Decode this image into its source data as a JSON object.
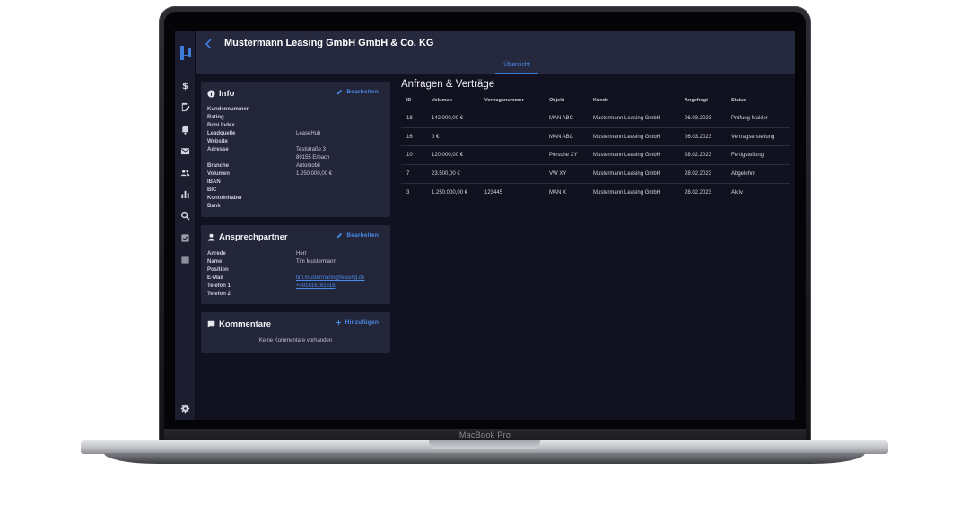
{
  "device": {
    "label": "MacBook Pro"
  },
  "app": {
    "title": "Mustermann Leasing GmbH GmbH & Co. KG",
    "tabs": [
      {
        "label": "Übersicht",
        "active": true
      }
    ],
    "accent_color": "#3d7bd9"
  },
  "sidebar": {
    "logo": "brand-logo",
    "items": [
      {
        "icon": "dollar-icon"
      },
      {
        "icon": "document-edit-icon"
      },
      {
        "icon": "bell-icon"
      },
      {
        "icon": "mail-icon"
      },
      {
        "icon": "people-icon"
      },
      {
        "icon": "bar-chart-icon"
      },
      {
        "icon": "search-icon"
      },
      {
        "icon": "checkbox-icon"
      },
      {
        "icon": "square-icon"
      }
    ],
    "footer_icon": "gear-icon"
  },
  "info": {
    "title": "Info",
    "action": "Bearbeiten",
    "fields": [
      {
        "key": "Kundennummer",
        "value": ""
      },
      {
        "key": "Rating",
        "value": ""
      },
      {
        "key": "Boni Index",
        "value": ""
      },
      {
        "key": "Leadquelle",
        "value": "LeaseHub"
      },
      {
        "key": "Website",
        "value": ""
      },
      {
        "key": "Adresse",
        "value": "Teststraße 3"
      },
      {
        "key": "",
        "value": "89155 Erbach"
      },
      {
        "key": "Branche",
        "value": "Automobil"
      },
      {
        "key": "Volumen",
        "value": "1.250.000,00 €"
      },
      {
        "key": "IBAN",
        "value": ""
      },
      {
        "key": "BIC",
        "value": ""
      },
      {
        "key": "Kontoinhaber",
        "value": ""
      },
      {
        "key": "Bank",
        "value": ""
      }
    ]
  },
  "contact": {
    "title": "Ansprechpartner",
    "action": "Bearbeiten",
    "fields": [
      {
        "key": "Anrede",
        "value": "Herr"
      },
      {
        "key": "Name",
        "value": "Tim Mustermann"
      },
      {
        "key": "Position",
        "value": ""
      },
      {
        "key": "E-Mail",
        "value": "tim.mustermann@leasing.de"
      },
      {
        "key": "Telefon 1",
        "value": "+491616161616"
      },
      {
        "key": "Telefon 2",
        "value": ""
      }
    ]
  },
  "comments": {
    "title": "Kommentare",
    "action": "Hinzufügen",
    "empty": "Keine Kommentare vorhanden"
  },
  "requests": {
    "title": "Anfragen & Verträge",
    "columns": [
      "ID",
      "Volumen",
      "Vertragsnummer",
      "Objekt",
      "Kunde",
      "Angefragt",
      "Status"
    ],
    "rows": [
      [
        "18",
        "142.000,00 €",
        "",
        "MAN ABC",
        "Mustermann Leasing GmbH",
        "06.03.2023",
        "Prüfung Makler"
      ],
      [
        "16",
        "0 €",
        "",
        "MAN ABC",
        "Mustermann Leasing GmbH",
        "06.03.2023",
        "Vertragserstellung"
      ],
      [
        "10",
        "120.000,00 €",
        "",
        "Porsche XY",
        "Mustermann Leasing GmbH",
        "28.02.2023",
        "Fertigstellung"
      ],
      [
        "7",
        "23.500,00 €",
        "",
        "VW XY",
        "Mustermann Leasing GmbH",
        "28.02.2023",
        "Abgelehnt"
      ],
      [
        "3",
        "1.250.000,00 €",
        "123445",
        "MAN X",
        "Mustermann Leasing GmbH",
        "28.02.2023",
        "Aktiv"
      ]
    ]
  }
}
